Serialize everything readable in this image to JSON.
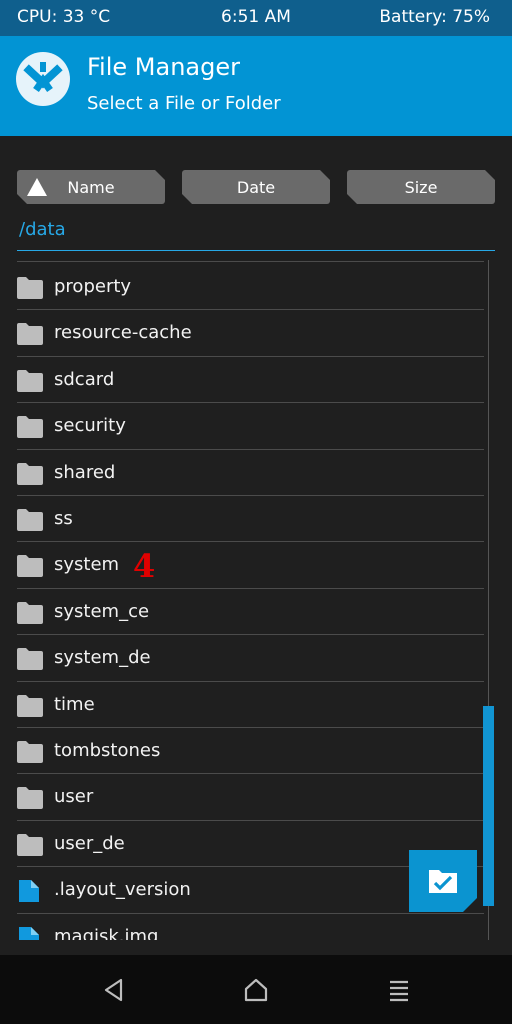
{
  "status": {
    "cpu": "CPU: 33 °C",
    "time": "6:51 AM",
    "battery": "Battery: 75%"
  },
  "header": {
    "title": "File Manager",
    "subtitle": "Select a File or Folder",
    "accent": "#0294d4"
  },
  "sort": {
    "name": "Name",
    "date": "Date",
    "size": "Size"
  },
  "path": "/data",
  "items": [
    {
      "name": "property",
      "type": "folder"
    },
    {
      "name": "resource-cache",
      "type": "folder"
    },
    {
      "name": "sdcard",
      "type": "folder"
    },
    {
      "name": "security",
      "type": "folder"
    },
    {
      "name": "shared",
      "type": "folder"
    },
    {
      "name": "ss",
      "type": "folder"
    },
    {
      "name": "system",
      "type": "folder"
    },
    {
      "name": "system_ce",
      "type": "folder"
    },
    {
      "name": "system_de",
      "type": "folder"
    },
    {
      "name": "time",
      "type": "folder"
    },
    {
      "name": "tombstones",
      "type": "folder"
    },
    {
      "name": "user",
      "type": "folder"
    },
    {
      "name": "user_de",
      "type": "folder"
    },
    {
      "name": ".layout_version",
      "type": "file"
    },
    {
      "name": "magisk.img",
      "type": "file"
    }
  ],
  "annotation": "4",
  "icons": {
    "folder": "folder-icon",
    "file": "file-icon",
    "fab": "select-folder-icon",
    "back": "back-icon",
    "home": "home-icon",
    "menu": "menu-icon"
  }
}
